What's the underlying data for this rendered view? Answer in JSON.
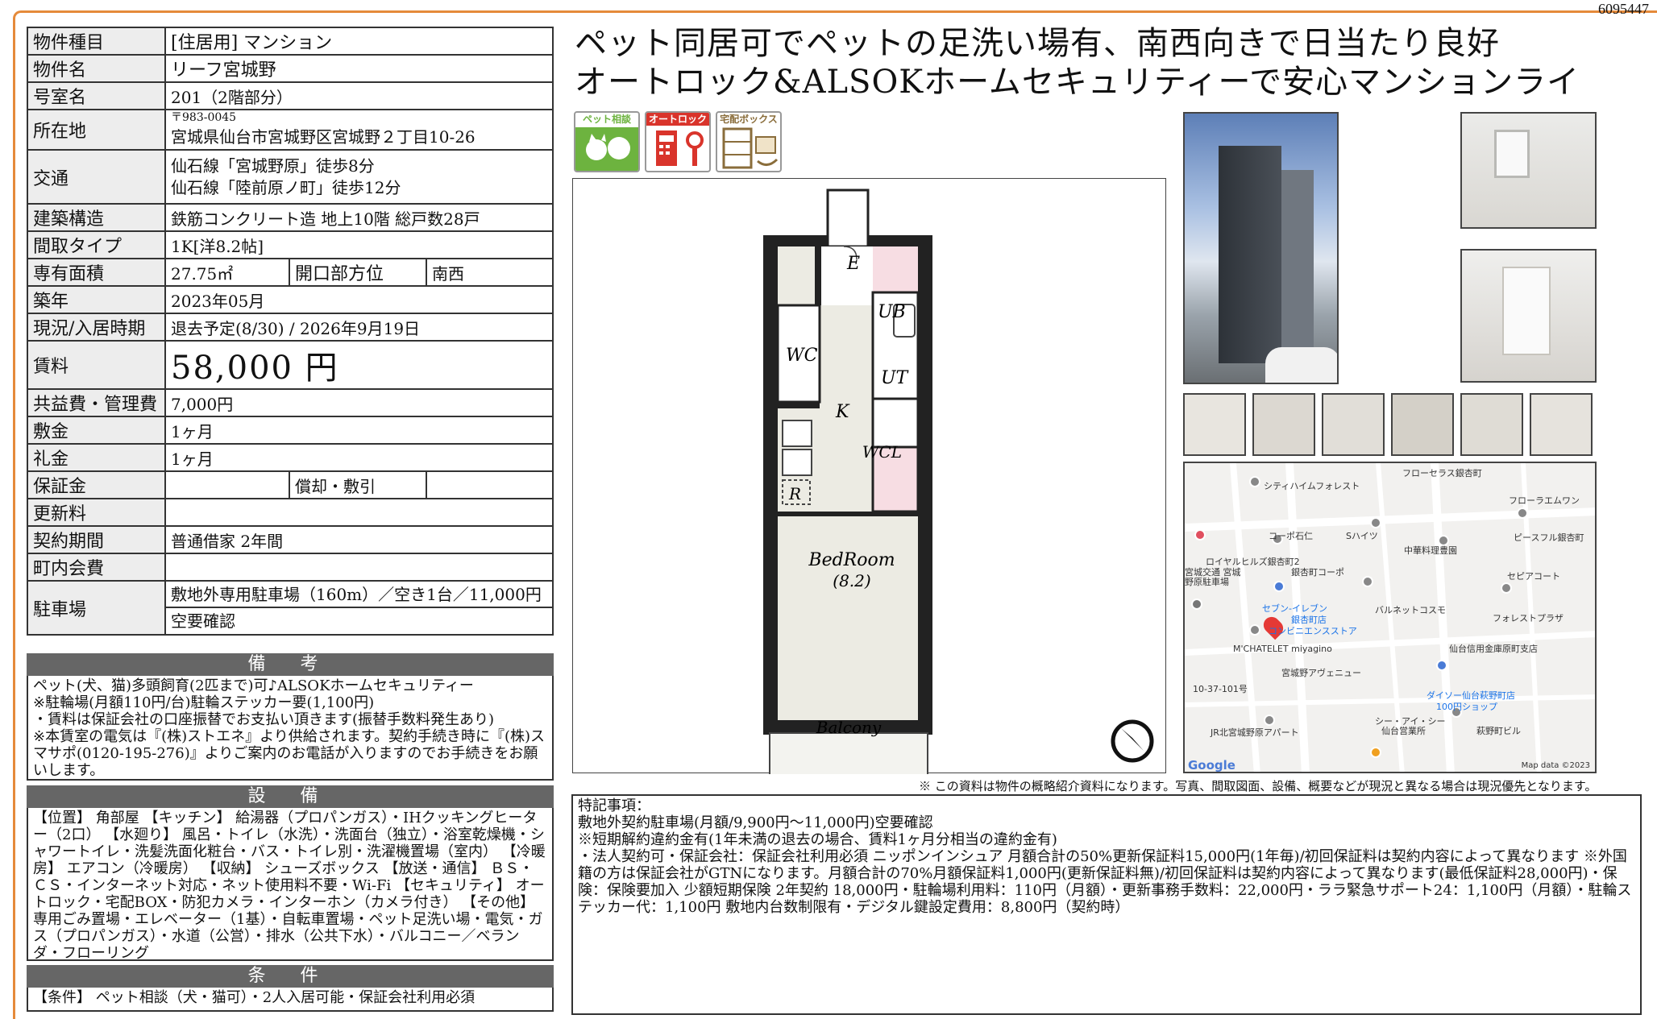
{
  "doc_id": "6095447",
  "property": {
    "type_label": "物件種目",
    "type_value": "[住居用] マンション",
    "name_label": "物件名",
    "name_value": "リーフ宮城野",
    "room_label": "号室名",
    "room_value": "201（2階部分）",
    "address_label": "所在地",
    "postal": "〒983-0045",
    "address": "宮城県仙台市宮城野区宮城野２丁目10-26",
    "traffic_label": "交通",
    "traffic_1": "仙石線「宮城野原」徒歩8分",
    "traffic_2": "仙石線「陸前原ノ町」徒歩12分",
    "structure_label": "建築構造",
    "structure_value": "鉄筋コンクリート造 地上10階 総戸数28戸",
    "layout_label": "間取タイプ",
    "layout_value": "1K[洋8.2帖]",
    "area_label": "専有面積",
    "area_value": "27.75㎡",
    "direction_label": "開口部方位",
    "direction_value": "南西",
    "built_label": "築年",
    "built_value": "2023年05月",
    "status_label": "現況/入居時期",
    "status_value": "退去予定(8/30) / 2026年9月19日",
    "rent_label": "賃料",
    "rent_value": "58,000 円",
    "fee_label": "共益費・管理費",
    "fee_value": "7,000円",
    "deposit_label": "敷金",
    "deposit_value": "1ヶ月",
    "key_label": "礼金",
    "key_value": "1ヶ月",
    "guarantee_label": "保証金",
    "guarantee_value": "",
    "amort_label": "償却・敷引",
    "amort_value": "",
    "renew_label": "更新料",
    "renew_value": "",
    "contract_label": "契約期間",
    "contract_value": "普通借家 2年間",
    "community_label": "町内会費",
    "community_value": "",
    "parking_label": "駐車場",
    "parking_1": "敷地外専用駐車場（160m）／空き1台／11,000円",
    "parking_2": "空要確認"
  },
  "remarks": {
    "title": "備 考",
    "text": "ペット(犬、猫)多頭飼育(2匹まで)可♪ALSOKホームセキュリティー\n※駐輪場(月額110円/台)駐輪ステッカー要(1,100円)\n・賃料は保証会社の口座振替でお支払い頂きます(振替手数料発生あり)\n※本賃室の電気は『(株)ストエネ』より供給されます。契約手続き時に『(株)スマサポ(0120-195-276)』よりご案内のお電話が入りますのでお手続きをお願いします。"
  },
  "equipment": {
    "title": "設 備",
    "text": "【位置】 角部屋 【キッチン】 給湯器（プロパンガス）・IHクッキングヒーター（2口） 【水廻り】 風呂・トイレ（水洗）・洗面台（独立）・浴室乾燥機・シャワートイレ・洗髪洗面化粧台・バス・トイレ別・洗濯機置場（室内） 【冷暖房】 エアコン（冷暖房） 【収納】 シューズボックス 【放送・通信】 ＢＳ・ＣＳ・インターネット対応・ネット使用料不要・Wi-Fi 【セキュリティ】 オートロック・宅配BOX・防犯カメラ・インターホン（カメラ付き） 【その他】 専用ごみ置場・エレベーター（1基）・自転車置場・ペット足洗い場・電気・ガス（プロパンガス）・水道（公営）・排水（公共下水）・バルコニー／ベランダ・フローリング"
  },
  "conditions": {
    "title": "条 件",
    "text": "【条件】 ペット相談（犬・猫可）・2人入居可能・保証会社利用必須"
  },
  "headline": {
    "line1": "ペット同居可でペットの足洗い場有、南西向きで日当たり良好",
    "line2": "オートロック&ALSOKホームセキュリティーで安心マンションライ"
  },
  "icons": [
    {
      "name": "ペット相談",
      "color": "#6db33f"
    },
    {
      "name": "オートロック",
      "color": "#d9342b"
    },
    {
      "name": "宅配ボックス",
      "color": "#8a6d3b"
    }
  ],
  "floorplan": {
    "e": "E",
    "wc": "WC",
    "ub": "UB",
    "ut": "UT",
    "k": "K",
    "r": "R",
    "wcl": "WCL",
    "bedroom": "BedRoom",
    "bedroom_size": "(8.2)",
    "balcony": "Balcony"
  },
  "map": {
    "labels": [
      "フローセラス銀杏町",
      "シティハイムフォレスト",
      "フローラエムワン",
      "コーポ石仁",
      "Sハイツ",
      "ピースフル銀杏町",
      "中華料理豊園",
      "ロイヤルヒルズ銀杏町2",
      "銀杏町コーポ",
      "宮城交通 宮城野原駐車場",
      "セピアコート",
      "バルネットコスモ",
      "セブン-イレブン",
      "銀杏町店",
      "コンビニエンスストア",
      "フォレストプラザ",
      "M'CHATELET miyagino",
      "仙台信用金庫原町支店",
      "宮城野アヴェニュー",
      "10-37-101号",
      "ダイソー仙台萩野町店",
      "100円ショップ",
      "シー・アイ・シー",
      "仙台営業所",
      "萩野町ビル",
      "JR北宮城野原アパート",
      "Google",
      "Map data ©2023"
    ]
  },
  "disclaimer": "※ この資料は物件の概略紹介資料になります。写真、間取図面、設備、概要などが現況と異なる場合は現況優先となります。",
  "notes": "特記事項：\n敷地外契約駐車場(月額/9,900円～11,000円)空要確認\n※短期解約違約金有(1年未満の退去の場合、賃料1ヶ月分相当の違約金有)\n・法人契約可・保証会社：保証会社利用必須 ニッポンインシュア 月額合計の50%更新保証料15,000円(1年毎)/初回保証料は契約内容によって異なります ※外国籍の方は保証会社がGTNになります。月額合計の70%月額保証料1,000円(更新保証料無)/初回保証料は契約内容によって異なります(最低保証料28,000円)・保険：保険要加入 少額短期保険 2年契約 18,000円・駐輪場利用料：110円（月額）・更新事務手数料：22,000円・ララ緊急サポート24：1,100円（月額）・駐輪ステッカー代：1,100円 敷地内台数制限有・デジタル鍵設定費用：8,800円（契約時）"
}
